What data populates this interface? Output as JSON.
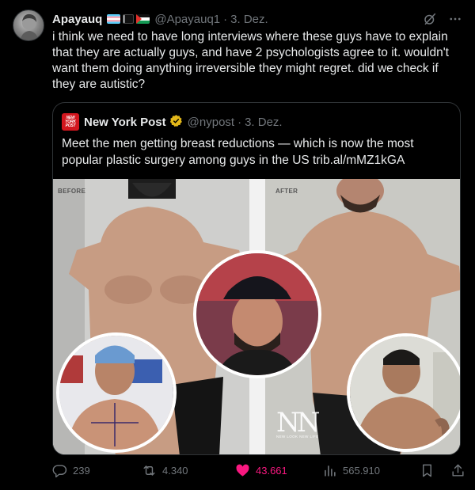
{
  "author": {
    "display_name": "Apayauq",
    "handle": "@Apayauq1",
    "date": "3. Dez.",
    "separator": "·",
    "flags": [
      "transgender-flag-icon",
      "black-flag-icon",
      "palestine-flag-icon"
    ]
  },
  "tweet": {
    "text": "i think we need to have long interviews where these guys have to explain that they are actually guys, and have 2 psychologists agree to it. wouldn't want them doing anything irreversible they might regret. did we check if they are autistic?"
  },
  "quote": {
    "logo_lines": [
      "NEW",
      "YORK",
      "POST"
    ],
    "display_name": "New York Post",
    "handle": "@nypost",
    "separator": "·",
    "date": "3. Dez.",
    "text": "Meet the men getting breast reductions — which is now the most popular plastic surgery among guys in the US trib.al/mMZ1kGA",
    "media": {
      "before_label": "BEFORE",
      "after_label": "AFTER",
      "logo_text": "NN",
      "logo_tagline": "NEW LOOK NEW LIFE"
    }
  },
  "actions": {
    "replies": "239",
    "reposts": "4.340",
    "likes": "43.661",
    "views": "565.910"
  },
  "colors": {
    "background": "#000000",
    "text": "#e7e9ea",
    "muted": "#71767b",
    "border": "#2f3336",
    "like": "#f91880",
    "verified_gold": "#e2b719",
    "nypost_red": "#d2161e"
  }
}
